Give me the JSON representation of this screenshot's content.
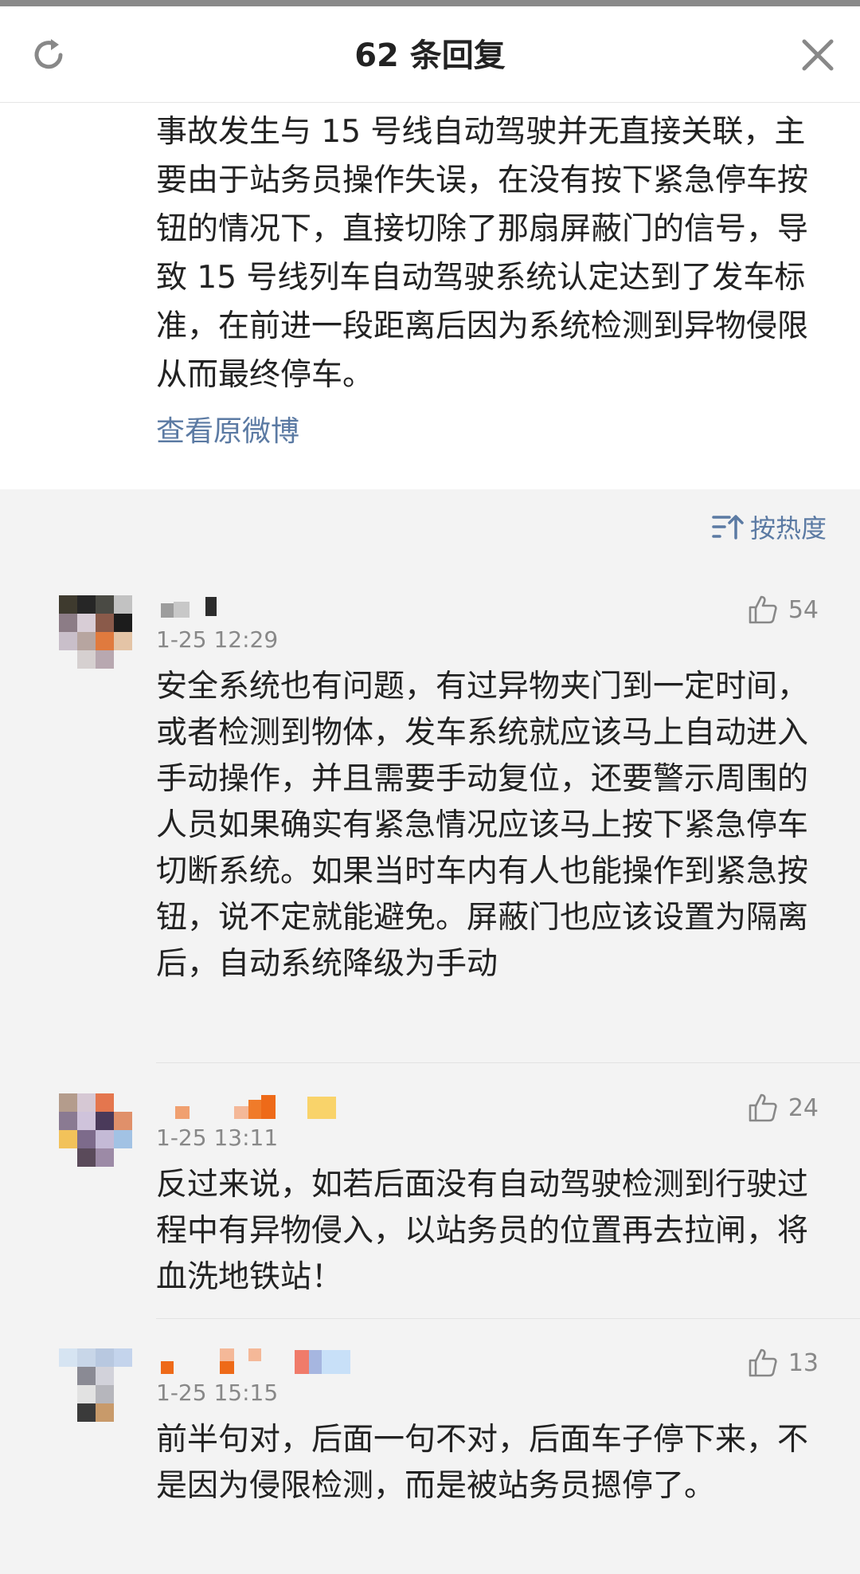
{
  "header": {
    "title": "62 条回复",
    "refresh_icon": "refresh-icon",
    "close_icon": "close-icon"
  },
  "original_post": {
    "text": "事故发生与 15 号线自动驾驶并无直接关联，主要由于站务员操作失误，在没有按下紧急停车按钮的情况下，直接切除了那扇屏蔽门的信号，导致 15 号线列车自动驾驶系统认定达到了发车标准，在前进一段距离后因为系统检测到异物侵限从而最终停车。",
    "view_original_label": "查看原微博"
  },
  "sort": {
    "label": "按热度",
    "icon": "sort-icon"
  },
  "comments": [
    {
      "time": "1-25 12:29",
      "likes": "54",
      "text": "安全系统也有问题，有过异物夹门到一定时间，或者检测到物体，发车系统就应该马上自动进入手动操作，并且需要手动复位，还要警示周围的人员如果确实有紧急情况应该马上按下紧急停车切断系统。如果当时车内有人也能操作到紧急按钮，说不定就能避免。屏蔽门也应该设置为隔离后，自动系统降级为手动"
    },
    {
      "time": "1-25 13:11",
      "likes": "24",
      "text": "反过来说，如若后面没有自动驾驶检测到行驶过程中有异物侵入，以站务员的位置再去拉闸，将血洗地铁站！"
    },
    {
      "time": "1-25 15:15",
      "likes": "13",
      "text": "前半句对，后面一句不对，后面车子停下来，不是因为侵限检测，而是被站务员摁停了。"
    }
  ],
  "colors": {
    "link": "#5b7aa3",
    "background": "#f3f3f3",
    "card": "#ffffff",
    "meta": "#888888"
  }
}
